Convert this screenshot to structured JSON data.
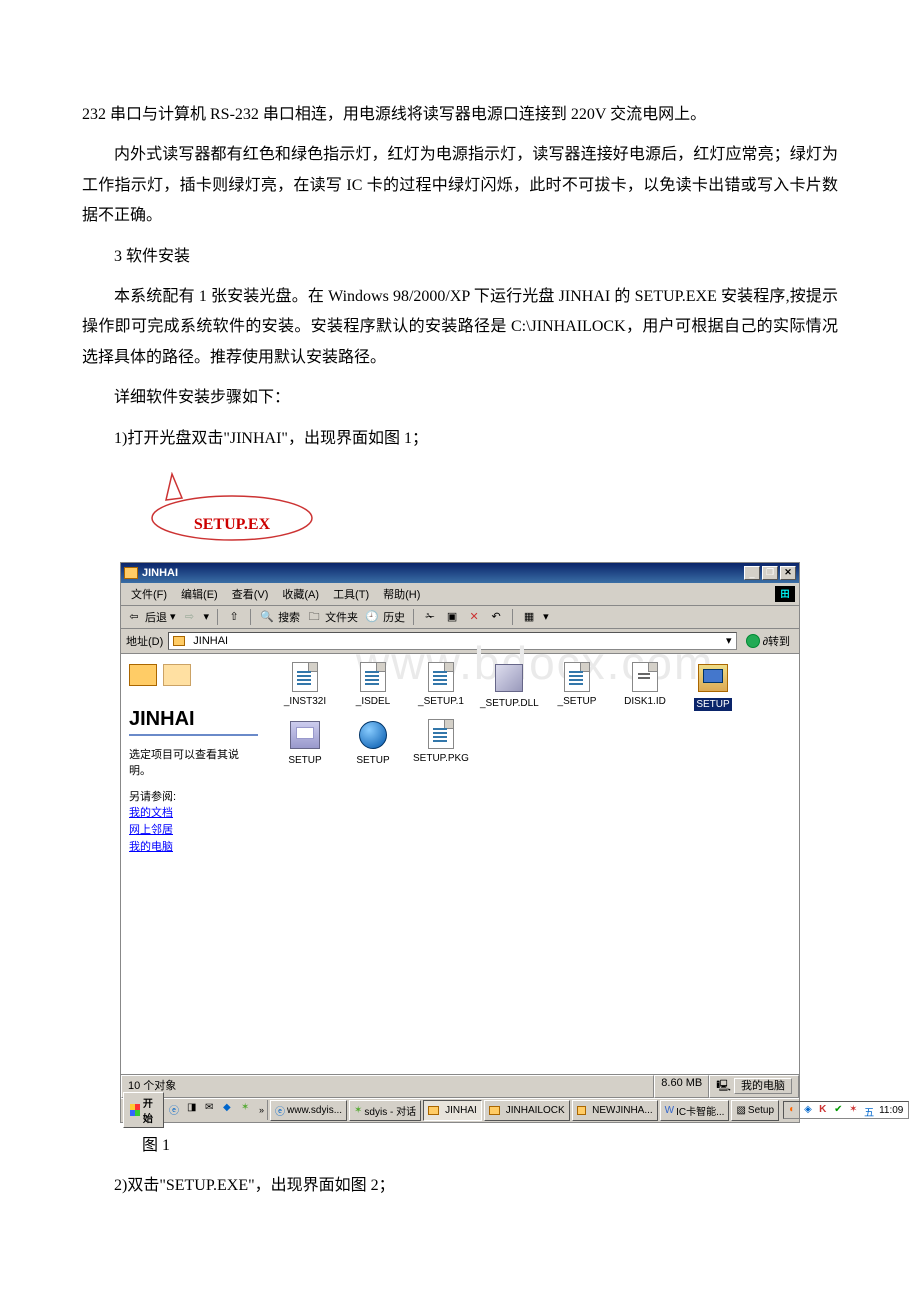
{
  "doc": {
    "p1": "232 串口与计算机 RS-232 串口相连，用电源线将读写器电源口连接到 220V 交流电网上。",
    "p2": "内外式读写器都有红色和绿色指示灯，红灯为电源指示灯，读写器连接好电源后，红灯应常亮；绿灯为工作指示灯，插卡则绿灯亮，在读写 IC 卡的过程中绿灯闪烁，此时不可拔卡，以免读卡出错或写入卡片数据不正确。",
    "p3": "3 软件安装",
    "p4": "本系统配有 1 张安装光盘。在 Windows 98/2000/XP 下运行光盘 JINHAI 的 SETUP.EXE 安装程序,按提示操作即可完成系统软件的安装。安装程序默认的安装路径是 C:\\JINHAILOCK，用户可根据自己的实际情况选择具体的路径。推荐使用默认安装路径。",
    "p5": "详细软件安装步骤如下：",
    "p6": "1)打开光盘双击\"JINHAI\"，出现界面如图 1；",
    "callout": "SETUP.EX",
    "fig1": "图 1",
    "p7": "2)双击\"SETUP.EXE\"，出现界面如图 2；"
  },
  "explorer": {
    "title": "JINHAI",
    "menu": {
      "file": "文件(F)",
      "edit": "编辑(E)",
      "view": "查看(V)",
      "fav": "收藏(A)",
      "tools": "工具(T)",
      "help": "帮助(H)"
    },
    "tb": {
      "back": "后退",
      "search": "搜索",
      "folders": "文件夹",
      "history": "历史"
    },
    "addr": {
      "label": "地址(D)",
      "value": "JINHAI",
      "go": "转到"
    },
    "side": {
      "heading": "JINHAI",
      "tip": "选定项目可以查看其说明。",
      "see": "另请参阅:",
      "links": [
        "我的文档",
        "网上邻居",
        "我的电脑"
      ]
    },
    "files": [
      "_INST32I",
      "_ISDEL",
      "_SETUP.1",
      "_SETUP.DLL",
      "_SETUP",
      "DISK1.ID",
      "SETUP",
      "SETUP",
      "SETUP",
      "SETUP.PKG"
    ],
    "status": {
      "objects": "10 个对象",
      "size": "8.60 MB",
      "loc": "我的电脑"
    },
    "taskbar": {
      "start": "开始",
      "tasks": [
        "www.sdyis...",
        "sdyis - 对话",
        "JINHAI",
        "JINHAILOCK",
        "NEWJINHA...",
        "IC卡智能...",
        "Setup"
      ],
      "time": "11:09"
    }
  }
}
